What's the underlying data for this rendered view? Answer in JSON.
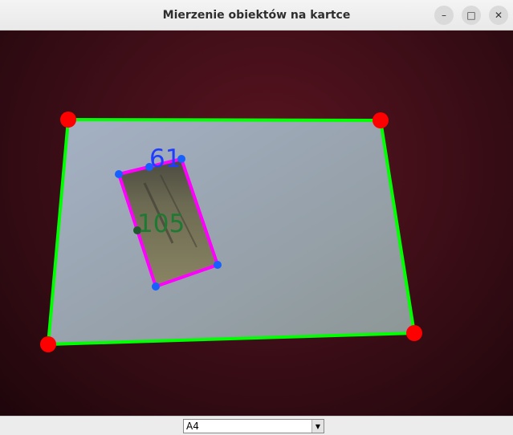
{
  "window": {
    "title": "Mierzenie obiektów na kartce",
    "minimize_label": "–",
    "maximize_label": "□",
    "close_label": "✕"
  },
  "camera_view": {
    "object": {
      "width_label": "61",
      "height_label": "105"
    },
    "colors": {
      "sheet_outline": "#00ff00",
      "sheet_corner": "#ff0000",
      "object_outline": "#ff00ff",
      "object_corner": "#1560ff",
      "width_label": "#1f3cff",
      "height_label": "#1e7a32"
    }
  },
  "paper_size_select": {
    "value": "A4",
    "arrow_icon": "chevron-down-icon"
  }
}
